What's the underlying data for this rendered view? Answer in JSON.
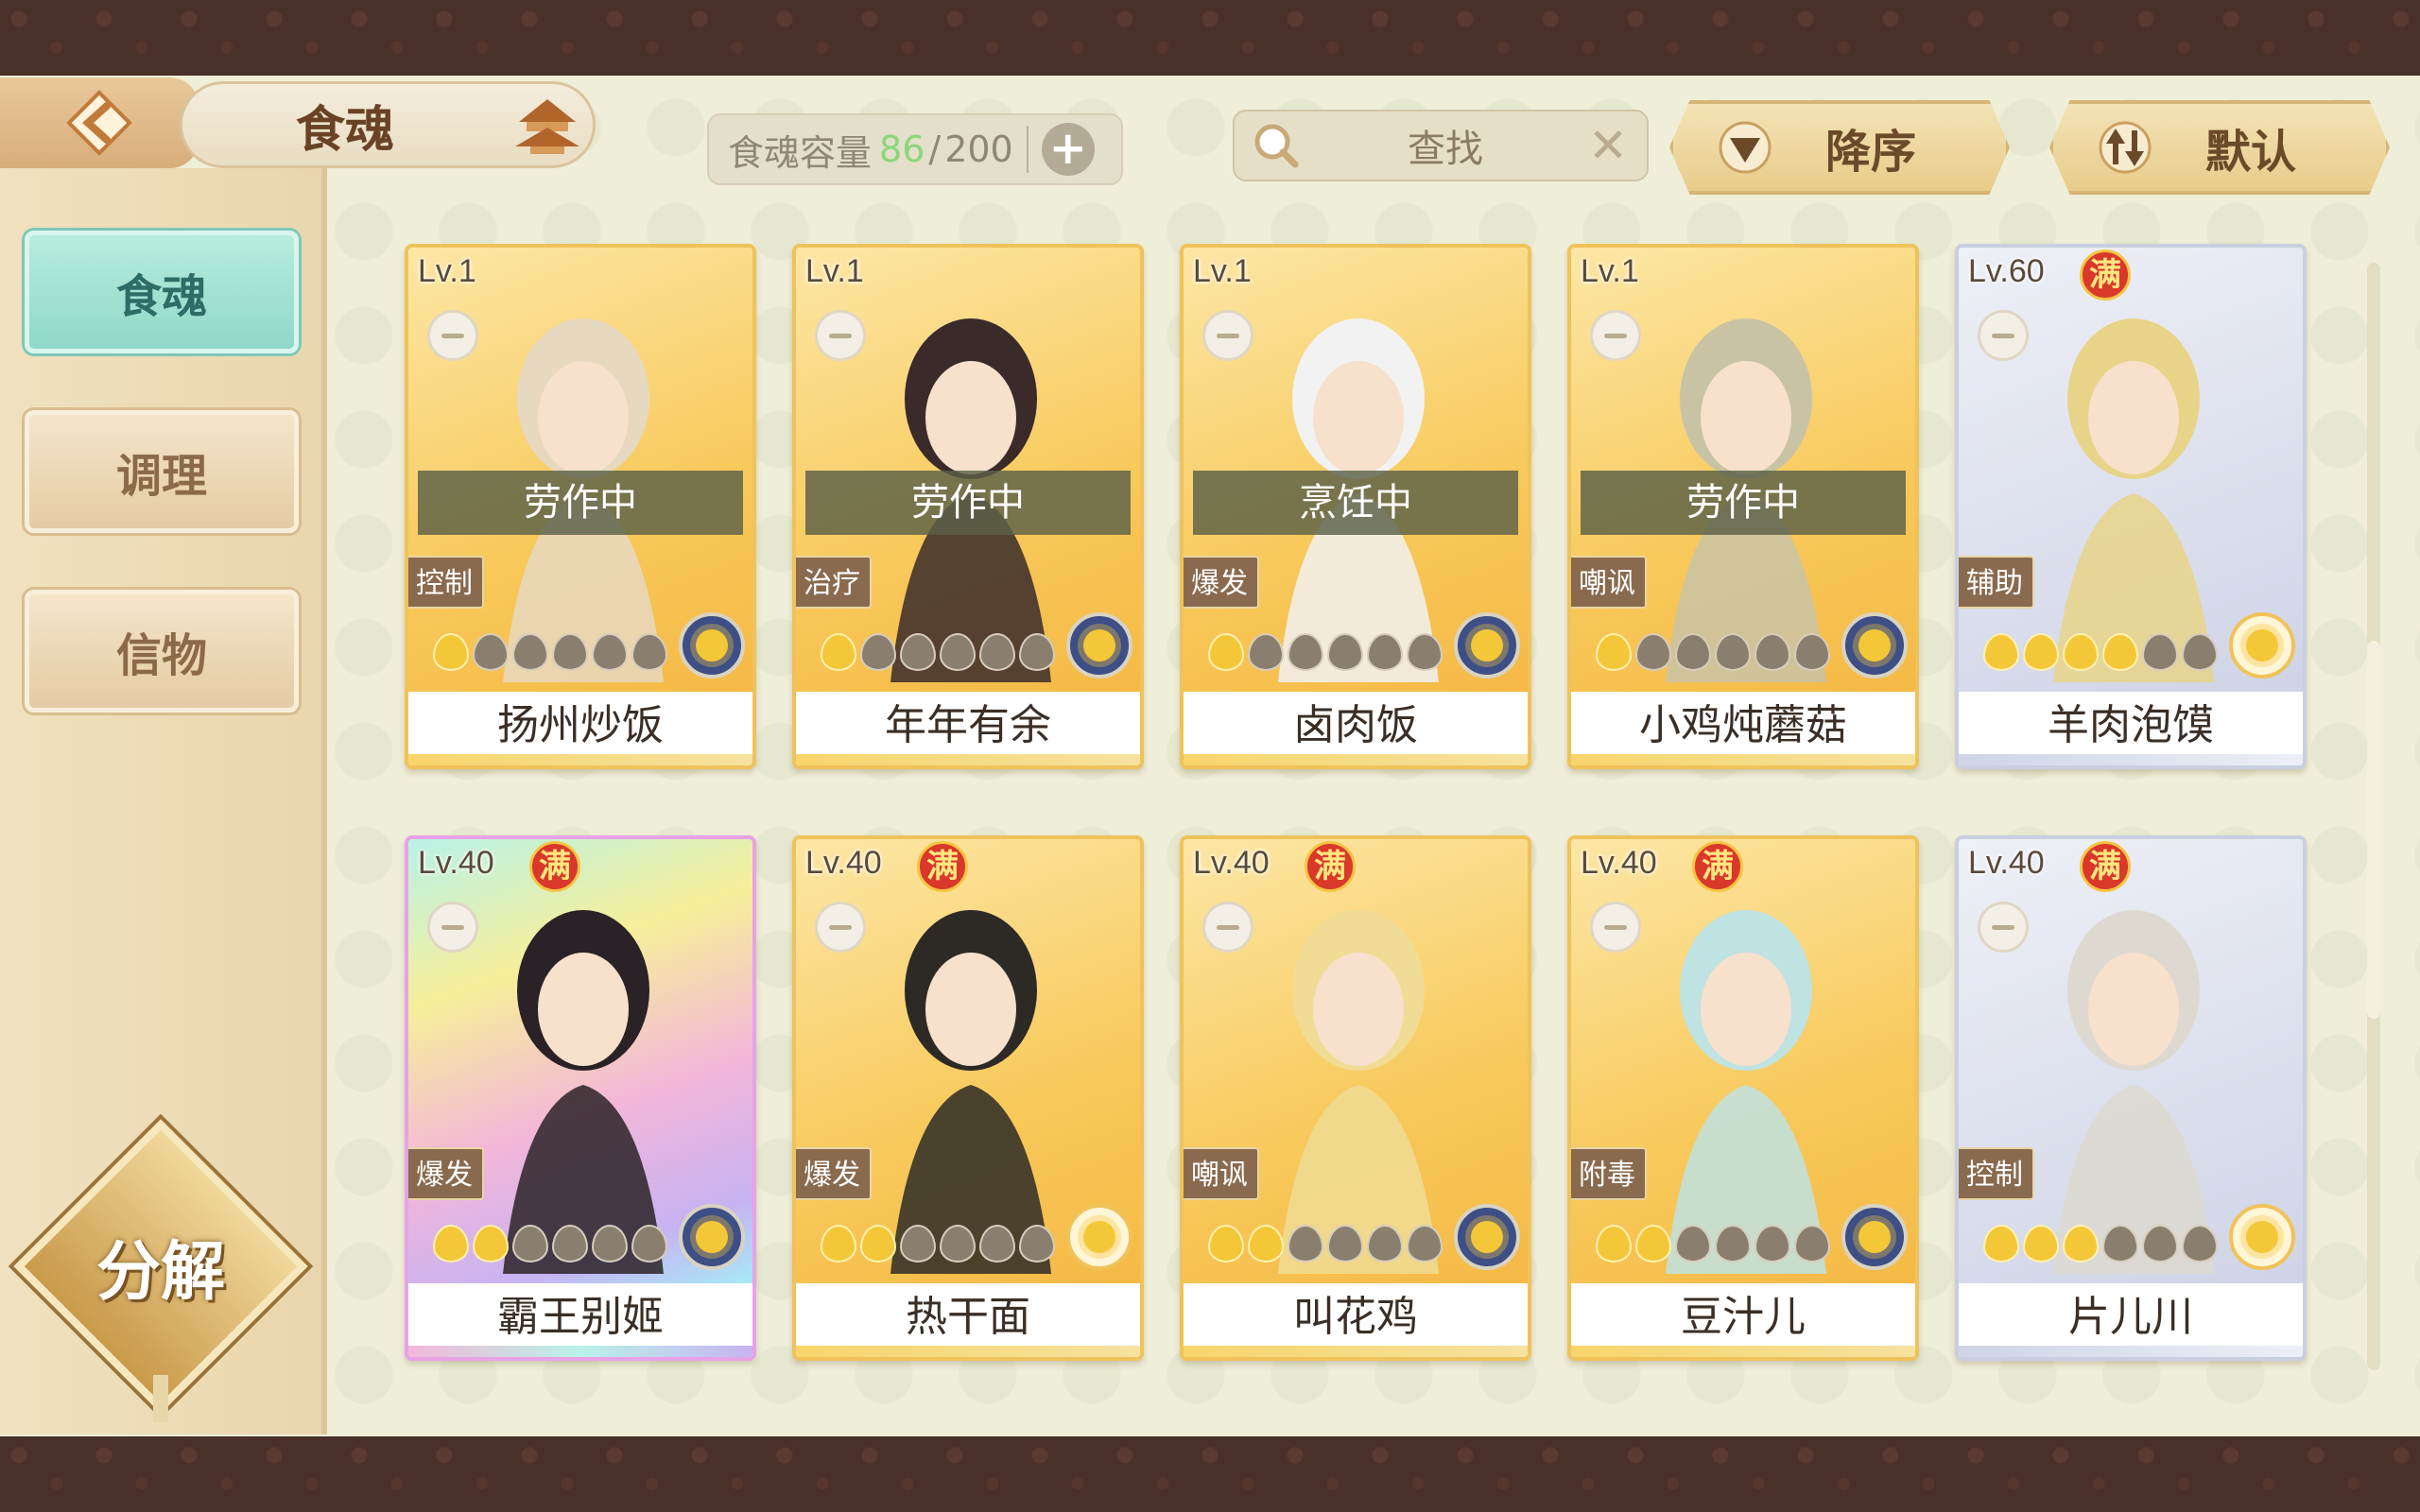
{
  "header": {
    "title": "食魂",
    "capacity": {
      "label": "食魂容量",
      "current": "86",
      "separator": "/",
      "max": "200"
    },
    "search": {
      "placeholder": "查找"
    },
    "sort_desc": "降序",
    "sort_default": "默认"
  },
  "sidebar": {
    "items": [
      {
        "label": "食魂",
        "active": true
      },
      {
        "label": "调理",
        "active": false
      },
      {
        "label": "信物",
        "active": false
      }
    ],
    "decompose_label": "分解"
  },
  "cards": [
    {
      "name": "扬州炒饭",
      "level": "Lv.1",
      "status": "劳作中",
      "role": "控制",
      "stars_lit": 1,
      "stars_total": 6,
      "frame": "gold",
      "max": false,
      "emblem": "blue"
    },
    {
      "name": "年年有余",
      "level": "Lv.1",
      "status": "劳作中",
      "role": "治疗",
      "stars_lit": 1,
      "stars_total": 6,
      "frame": "gold",
      "max": false,
      "emblem": "blue"
    },
    {
      "name": "卤肉饭",
      "level": "Lv.1",
      "status": "烹饪中",
      "role": "爆发",
      "stars_lit": 1,
      "stars_total": 6,
      "frame": "gold",
      "max": false,
      "emblem": "blue"
    },
    {
      "name": "小鸡炖蘑菇",
      "level": "Lv.1",
      "status": "劳作中",
      "role": "嘲讽",
      "stars_lit": 1,
      "stars_total": 6,
      "frame": "gold",
      "max": false,
      "emblem": "blue"
    },
    {
      "name": "羊肉泡馍",
      "level": "Lv.60",
      "status": "",
      "role": "辅助",
      "stars_lit": 4,
      "stars_total": 6,
      "frame": "silver",
      "max": true,
      "emblem": "gold"
    },
    {
      "name": "霸王别姬",
      "level": "Lv.40",
      "status": "",
      "role": "爆发",
      "stars_lit": 2,
      "stars_total": 6,
      "frame": "rainbow",
      "max": true,
      "emblem": "blue"
    },
    {
      "name": "热干面",
      "level": "Lv.40",
      "status": "",
      "role": "爆发",
      "stars_lit": 2,
      "stars_total": 6,
      "frame": "gold",
      "max": true,
      "emblem": "gold"
    },
    {
      "name": "叫花鸡",
      "level": "Lv.40",
      "status": "",
      "role": "嘲讽",
      "stars_lit": 2,
      "stars_total": 6,
      "frame": "gold",
      "max": true,
      "emblem": "blue"
    },
    {
      "name": "豆汁儿",
      "level": "Lv.40",
      "status": "",
      "role": "附毒",
      "stars_lit": 2,
      "stars_total": 6,
      "frame": "gold",
      "max": true,
      "emblem": "blue"
    },
    {
      "name": "片儿川",
      "level": "Lv.40",
      "status": "",
      "role": "控制",
      "stars_lit": 3,
      "stars_total": 6,
      "frame": "silver",
      "max": true,
      "emblem": "gold"
    }
  ],
  "max_badge_label": "满",
  "colors": {
    "accent_teal": "#8fd8c8",
    "gold_frame": "#f0c25a",
    "panel_bg": "#efeed9",
    "frame_brown": "#4a302a"
  }
}
